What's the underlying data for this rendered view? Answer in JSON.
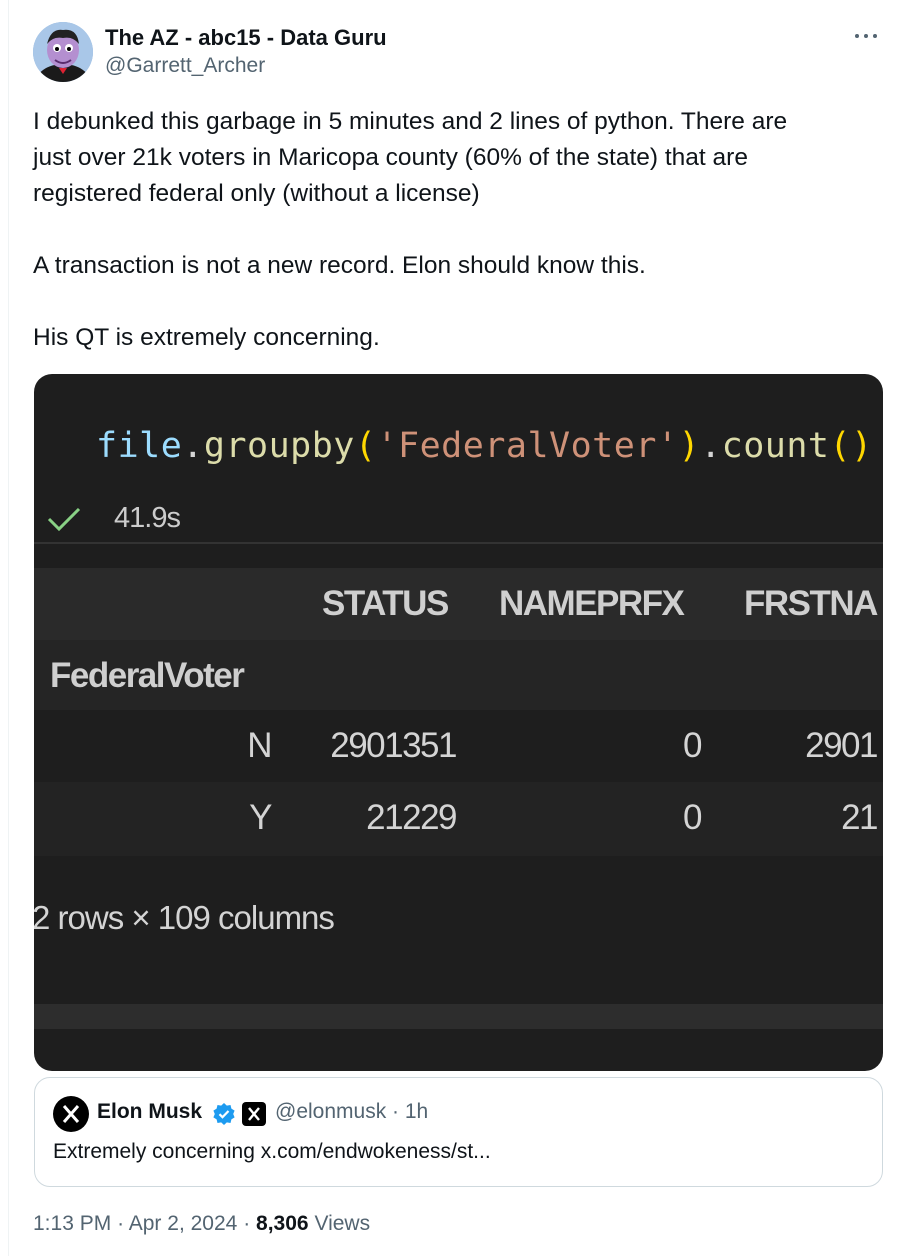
{
  "author": {
    "display_name": "The AZ - abc15 - Data Guru",
    "handle": "@Garrett_Archer"
  },
  "tweet": {
    "lines": [
      "I debunked this garbage in 5 minutes and 2 lines of python. There are",
      "just over 21k voters in Maricopa county (60% of the state) that are",
      "registered federal only (without a license)",
      "A transaction is not a new record. Elon should know this.",
      "His QT is extremely concerning."
    ]
  },
  "media": {
    "code": {
      "ident": "file",
      "dot1": ".",
      "func": "groupby",
      "open": "(",
      "arg": "'FederalVoter'",
      "close": ")",
      "dot2": ".",
      "func2": "count",
      "call": "()"
    },
    "exec_time": "41.9s",
    "table": {
      "columns": [
        "STATUS",
        "NAMEPRFX",
        "FRSTNA"
      ],
      "index_name": "FederalVoter",
      "rows": [
        {
          "index": "N",
          "cells": [
            "2901351",
            "0",
            "2901"
          ]
        },
        {
          "index": "Y",
          "cells": [
            "21229",
            "0",
            "21"
          ]
        }
      ]
    },
    "shape_info": "2 rows × 109 columns"
  },
  "quote": {
    "name": "Elon Musk",
    "handle_time": "@elonmusk · 1h",
    "text": "Extremely concerning x.com/endwokeness/st..."
  },
  "meta": {
    "time": "1:13 PM",
    "sep": "·",
    "date": "Apr 2, 2024",
    "views_count": "8,306",
    "views_label": "Views"
  },
  "colors": {
    "verified_blue": "#1d9bf0",
    "check_green": "#89d185"
  },
  "icons": {
    "more": "more-icon",
    "check": "check-icon",
    "verified": "verified-badge-icon",
    "x_logo": "x-logo-icon"
  }
}
